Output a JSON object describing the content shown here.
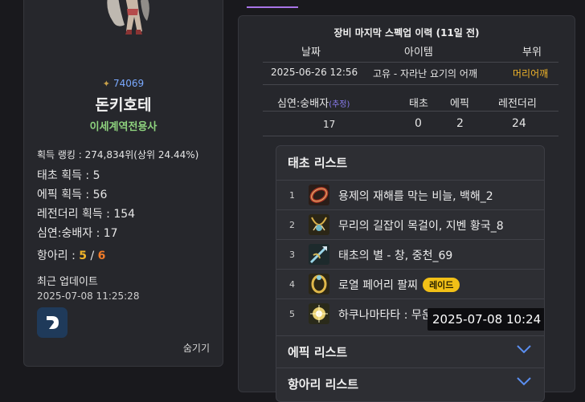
{
  "profile": {
    "server_rank": "74069",
    "name": "돈키호테",
    "job": "이세계역전용사",
    "rank_text": "획득 랭킹 : 274,834위(상위 24.44%)",
    "taecho": "태초 획득 : 5",
    "epic": "에픽 획득 : 56",
    "legendary": "레전더리 획득 : 154",
    "shimyeon": "심연:숭배자 : 17",
    "hangari_label": "항아리 : ",
    "hangari_v1": "5",
    "hangari_sep": " / ",
    "hangari_v2": "6",
    "update_label": "최근 업데이트",
    "update_time": "2025-07-08 11:25:28",
    "hide_button": "숨기기",
    "accent_color": "#8ed37e"
  },
  "history": {
    "title": "장비 마지막 스펙업 이력 (11일 전)",
    "headers": {
      "date": "날짜",
      "item": "아이템",
      "slot": "부위"
    },
    "row": {
      "date": "2025-06-26 12:56",
      "item": "고유 - 자라난 요기의 어깨",
      "slot": "머리어깨"
    },
    "slot_color": "#f0b429"
  },
  "counts": {
    "headers": {
      "shimyeon": "심연:숭배자",
      "estimate": "(추정)",
      "taecho": "태초",
      "epic": "에픽",
      "legendary": "레전더리"
    },
    "values": {
      "shimyeon": "17",
      "taecho": "0",
      "epic": "2",
      "legendary": "24"
    }
  },
  "taecho_list": {
    "title": "태초 리스트",
    "items": [
      {
        "num": "1",
        "label": "용제의 재해를 막는 비늘, 백해_2",
        "badge": "",
        "icon": "ring-icon"
      },
      {
        "num": "2",
        "label": "무리의 길잡이 목걸이, 지벤 황국_8",
        "badge": "",
        "icon": "necklace-icon"
      },
      {
        "num": "3",
        "label": "태초의 별 - 창, 중천_69",
        "badge": "",
        "icon": "spear-icon"
      },
      {
        "num": "4",
        "label": "로열 페어리 팔찌",
        "badge": "레이드",
        "icon": "bracelet-icon"
      },
      {
        "num": "5",
        "label": "하쿠나마타타 : 무운 - 중천_52",
        "badge": "",
        "icon": "emblem-icon"
      }
    ],
    "tooltip": "2025-07-08 10:24"
  },
  "sections": {
    "epic": "에픽 리스트",
    "hangari": "항아리 리스트"
  }
}
